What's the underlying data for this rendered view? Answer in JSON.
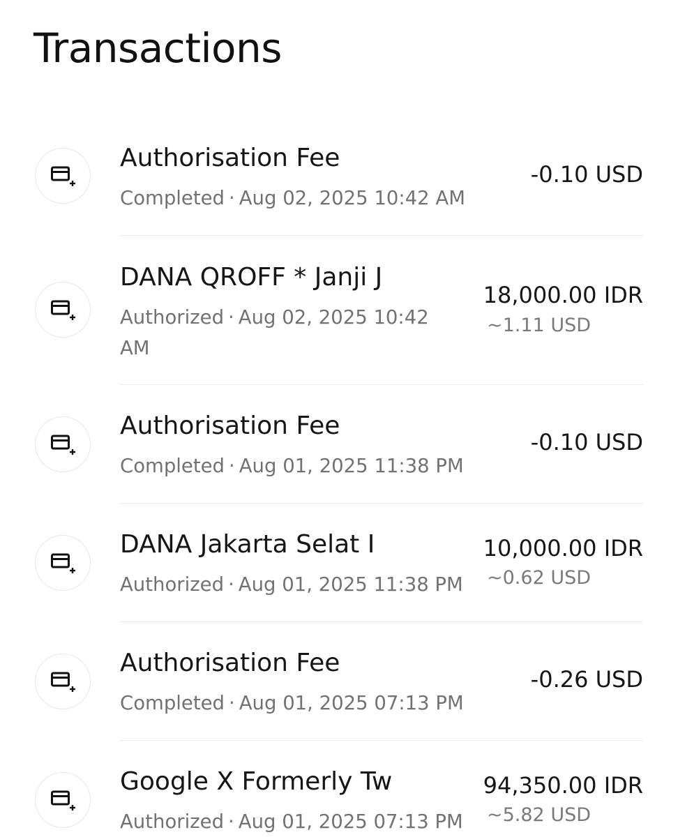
{
  "header": {
    "title": "Transactions"
  },
  "transactions": [
    {
      "title": "Authorisation Fee",
      "status": "Completed",
      "datetime": "Aug 02, 2025 10:42 AM",
      "amount": "-0.10 USD",
      "converted": "",
      "icon": "card-add-icon"
    },
    {
      "title": "DANA QROFF * Janji J",
      "status": "Authorized",
      "datetime": "Aug 02, 2025 10:42 AM",
      "amount": "18,000.00 IDR",
      "converted": "~1.11 USD",
      "icon": "card-add-icon"
    },
    {
      "title": "Authorisation Fee",
      "status": "Completed",
      "datetime": "Aug 01, 2025 11:38 PM",
      "amount": "-0.10 USD",
      "converted": "",
      "icon": "card-add-icon"
    },
    {
      "title": "DANA Jakarta Selat I",
      "status": "Authorized",
      "datetime": "Aug 01, 2025 11:38 PM",
      "amount": "10,000.00 IDR",
      "converted": "~0.62 USD",
      "icon": "card-add-icon"
    },
    {
      "title": "Authorisation Fee",
      "status": "Completed",
      "datetime": "Aug 01, 2025 07:13 PM",
      "amount": "-0.26 USD",
      "converted": "",
      "icon": "card-add-icon"
    },
    {
      "title": "Google X Formerly Tw",
      "status": "Authorized",
      "datetime": "Aug 01, 2025 07:13 PM",
      "amount": "94,350.00 IDR",
      "converted": "~5.82 USD",
      "icon": "card-add-icon"
    }
  ],
  "separator": "·"
}
